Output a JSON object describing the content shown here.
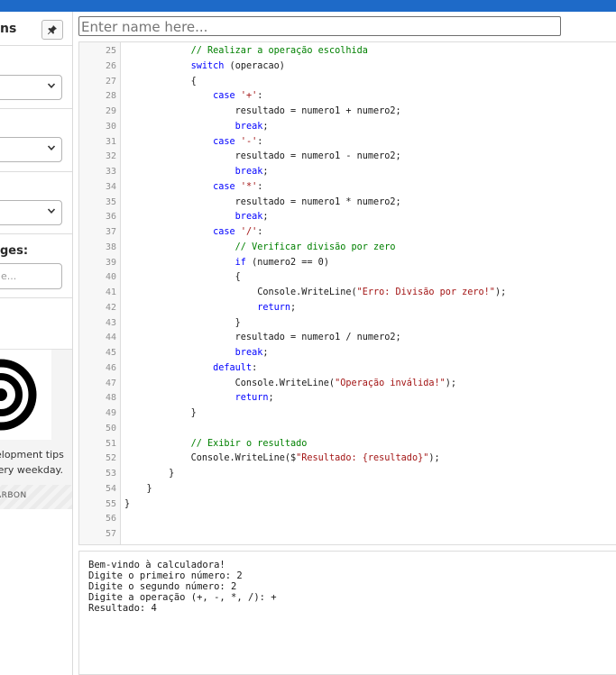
{
  "sidebar": {
    "title": "ns",
    "pin_icon": "pin-icon",
    "messages_label": "ges:",
    "messages_placeholder": "e...",
    "ad": {
      "text_line1": "elopment tips",
      "text_line2": "ery weekday.",
      "brand": "ARBON"
    }
  },
  "name_input": {
    "placeholder": "Enter name here..."
  },
  "editor": {
    "line_numbers": [
      "25",
      "26",
      "27",
      "28",
      "29",
      "30",
      "31",
      "32",
      "33",
      "34",
      "35",
      "36",
      "37",
      "38",
      "39",
      "40",
      "41",
      "42",
      "43",
      "44",
      "45",
      "46",
      "47",
      "48",
      "49",
      "50",
      "51",
      "52",
      "53",
      "54",
      "55",
      "56",
      "57"
    ],
    "lines": [
      [
        {
          "t": "            "
        },
        {
          "t": "// Realizar a operação escolhida",
          "c": "cm"
        }
      ],
      [
        {
          "t": "            "
        },
        {
          "t": "switch",
          "c": "kw"
        },
        {
          "t": " (operacao)"
        }
      ],
      [
        {
          "t": "            {"
        }
      ],
      [
        {
          "t": "                "
        },
        {
          "t": "case",
          "c": "kw"
        },
        {
          "t": " "
        },
        {
          "t": "'+'",
          "c": "st"
        },
        {
          "t": ":"
        }
      ],
      [
        {
          "t": "                    resultado = numero1 + numero2;"
        }
      ],
      [
        {
          "t": "                    "
        },
        {
          "t": "break",
          "c": "kw"
        },
        {
          "t": ";"
        }
      ],
      [
        {
          "t": "                "
        },
        {
          "t": "case",
          "c": "kw"
        },
        {
          "t": " "
        },
        {
          "t": "'-'",
          "c": "st"
        },
        {
          "t": ":"
        }
      ],
      [
        {
          "t": "                    resultado = numero1 - numero2;"
        }
      ],
      [
        {
          "t": "                    "
        },
        {
          "t": "break",
          "c": "kw"
        },
        {
          "t": ";"
        }
      ],
      [
        {
          "t": "                "
        },
        {
          "t": "case",
          "c": "kw"
        },
        {
          "t": " "
        },
        {
          "t": "'*'",
          "c": "st"
        },
        {
          "t": ":"
        }
      ],
      [
        {
          "t": "                    resultado = numero1 * numero2;"
        }
      ],
      [
        {
          "t": "                    "
        },
        {
          "t": "break",
          "c": "kw"
        },
        {
          "t": ";"
        }
      ],
      [
        {
          "t": "                "
        },
        {
          "t": "case",
          "c": "kw"
        },
        {
          "t": " "
        },
        {
          "t": "'/'",
          "c": "st"
        },
        {
          "t": ":"
        }
      ],
      [
        {
          "t": "                    "
        },
        {
          "t": "// Verificar divisão por zero",
          "c": "cm"
        }
      ],
      [
        {
          "t": "                    "
        },
        {
          "t": "if",
          "c": "kw"
        },
        {
          "t": " (numero2 == 0)"
        }
      ],
      [
        {
          "t": "                    {"
        }
      ],
      [
        {
          "t": "                        Console.WriteLine("
        },
        {
          "t": "\"Erro: Divisão por zero!\"",
          "c": "st"
        },
        {
          "t": ");"
        }
      ],
      [
        {
          "t": "                        "
        },
        {
          "t": "return",
          "c": "kw"
        },
        {
          "t": ";"
        }
      ],
      [
        {
          "t": "                    }"
        }
      ],
      [
        {
          "t": "                    resultado = numero1 / numero2;"
        }
      ],
      [
        {
          "t": "                    "
        },
        {
          "t": "break",
          "c": "kw"
        },
        {
          "t": ";"
        }
      ],
      [
        {
          "t": "                "
        },
        {
          "t": "default",
          "c": "kw"
        },
        {
          "t": ":"
        }
      ],
      [
        {
          "t": "                    Console.WriteLine("
        },
        {
          "t": "\"Operação inválida!\"",
          "c": "st"
        },
        {
          "t": ");"
        }
      ],
      [
        {
          "t": "                    "
        },
        {
          "t": "return",
          "c": "kw"
        },
        {
          "t": ";"
        }
      ],
      [
        {
          "t": "            }"
        }
      ],
      [
        {
          "t": ""
        }
      ],
      [
        {
          "t": "            "
        },
        {
          "t": "// Exibir o resultado",
          "c": "cm"
        }
      ],
      [
        {
          "t": "            Console.WriteLine($"
        },
        {
          "t": "\"Resultado: {resultado}\"",
          "c": "st"
        },
        {
          "t": ");"
        }
      ],
      [
        {
          "t": "        }"
        }
      ],
      [
        {
          "t": "    }"
        }
      ],
      [
        {
          "t": "}"
        }
      ],
      [
        {
          "t": ""
        }
      ],
      [
        {
          "t": ""
        }
      ]
    ]
  },
  "console": {
    "lines": [
      "Bem-vindo à calculadora!",
      "Digite o primeiro número: 2",
      "Digite o segundo número: 2",
      "Digite a operação (+, -, *, /): +",
      "Resultado: 4"
    ]
  },
  "colors": {
    "topbar": "#1e6ac8",
    "keyword": "#0000ff",
    "comment": "#008000",
    "string": "#a31515"
  }
}
